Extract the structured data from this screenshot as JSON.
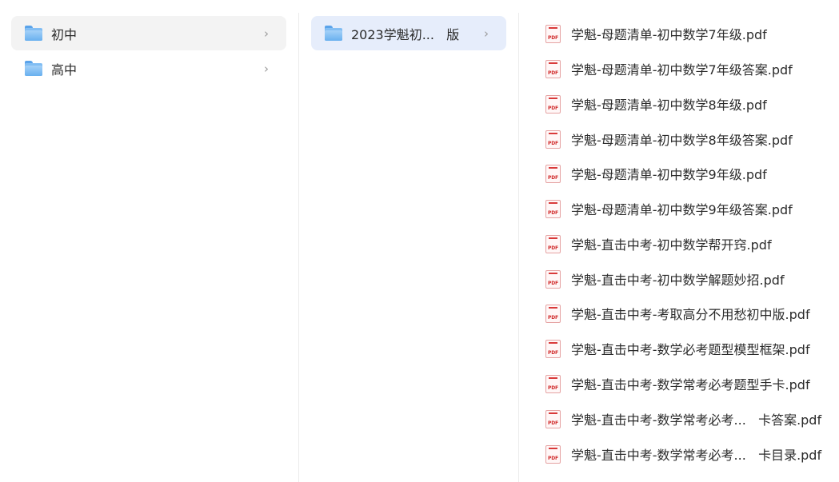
{
  "column1": {
    "items": [
      {
        "label": "初中",
        "icon": "folder-icon",
        "selected": true
      },
      {
        "label": "高中",
        "icon": "folder-icon",
        "selected": false
      }
    ],
    "chevron": "›"
  },
  "column2": {
    "items": [
      {
        "label": "2023学魁初...   版",
        "icon": "folder-icon",
        "active": true
      }
    ],
    "chevron": "›"
  },
  "column3": {
    "pdf_badge": "PDF",
    "files": [
      "学魁-母题清单-初中数学7年级.pdf",
      "学魁-母题清单-初中数学7年级答案.pdf",
      "学魁-母题清单-初中数学8年级.pdf",
      "学魁-母题清单-初中数学8年级答案.pdf",
      "学魁-母题清单-初中数学9年级.pdf",
      "学魁-母题清单-初中数学9年级答案.pdf",
      "学魁-直击中考-初中数学帮开窍.pdf",
      "学魁-直击中考-初中数学解题妙招.pdf",
      "学魁-直击中考-考取高分不用愁初中版.pdf",
      "学魁-直击中考-数学必考题型模型框架.pdf",
      "学魁-直击中考-数学常考必考题型手卡.pdf",
      "学魁-直击中考-数学常考必考...   卡答案.pdf",
      "学魁-直击中考-数学常考必考...   卡目录.pdf"
    ]
  },
  "colors": {
    "selected_bg": "#f3f3f3",
    "active_bg": "#e6edfb",
    "folder_blue": "#69b0ef",
    "pdf_red": "#d12b2b"
  }
}
